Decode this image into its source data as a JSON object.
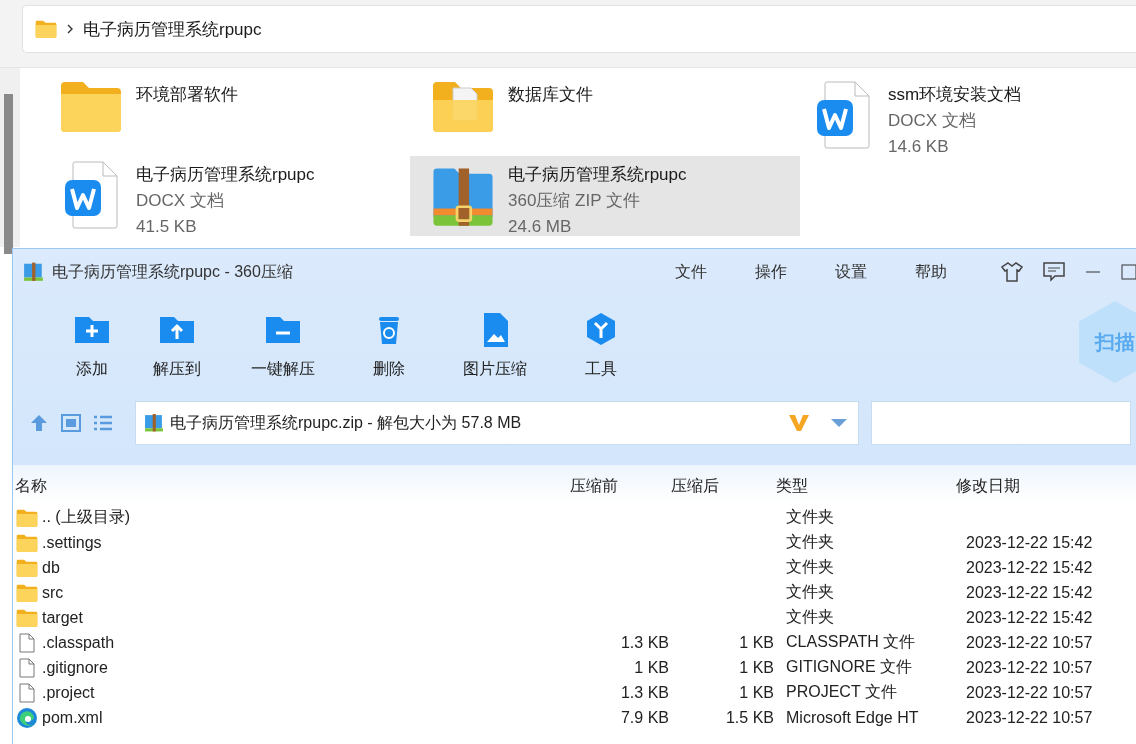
{
  "explorer": {
    "breadcrumb": "电子病历管理系统rpupc",
    "items": [
      {
        "kind": "folder",
        "name": "环境部署软件",
        "selected": false
      },
      {
        "kind": "folder-doc",
        "name": "数据库文件",
        "selected": false
      },
      {
        "kind": "word",
        "name": "ssm环境安装文档",
        "type": "DOCX 文档",
        "size": "14.6 KB",
        "selected": false
      },
      {
        "kind": "word",
        "name": "电子病历管理系统rpupc",
        "type": "DOCX 文档",
        "size": "41.5 KB",
        "selected": false
      },
      {
        "kind": "zip",
        "name": "电子病历管理系统rpupc",
        "type": "360压缩 ZIP 文件",
        "size": "24.6 MB",
        "selected": true
      }
    ]
  },
  "zip_window": {
    "title": "电子病历管理系统rpupc - 360压缩",
    "menu": [
      "文件",
      "操作",
      "设置",
      "帮助"
    ],
    "tools": [
      {
        "kind": "add",
        "label": "添加"
      },
      {
        "kind": "extract-to",
        "label": "解压到"
      },
      {
        "kind": "one-click",
        "label": "一键解压"
      },
      {
        "kind": "delete",
        "label": "删除"
      },
      {
        "kind": "image",
        "label": "图片压缩"
      },
      {
        "kind": "tools",
        "label": "工具"
      }
    ],
    "scan_button": "扫描",
    "path": "电子病历管理系统rpupc.zip - 解包大小为 57.8 MB",
    "columns": [
      "名称",
      "压缩前",
      "压缩后",
      "类型",
      "修改日期"
    ],
    "rows": [
      {
        "kind": "folder",
        "name": ".. (上级目录)",
        "before": "",
        "after": "",
        "type": "文件夹",
        "date": ""
      },
      {
        "kind": "folder",
        "name": ".settings",
        "before": "",
        "after": "",
        "type": "文件夹",
        "date": "2023-12-22 15:42"
      },
      {
        "kind": "folder",
        "name": "db",
        "before": "",
        "after": "",
        "type": "文件夹",
        "date": "2023-12-22 15:42"
      },
      {
        "kind": "folder",
        "name": "src",
        "before": "",
        "after": "",
        "type": "文件夹",
        "date": "2023-12-22 15:42"
      },
      {
        "kind": "folder",
        "name": "target",
        "before": "",
        "after": "",
        "type": "文件夹",
        "date": "2023-12-22 15:42"
      },
      {
        "kind": "file",
        "name": ".classpath",
        "before": "1.3 KB",
        "after": "1 KB",
        "type": "CLASSPATH 文件",
        "date": "2023-12-22 10:57"
      },
      {
        "kind": "file",
        "name": ".gitignore",
        "before": "1 KB",
        "after": "1 KB",
        "type": "GITIGNORE 文件",
        "date": "2023-12-22 10:57"
      },
      {
        "kind": "file",
        "name": ".project",
        "before": "1.3 KB",
        "after": "1 KB",
        "type": "PROJECT 文件",
        "date": "2023-12-22 10:57"
      },
      {
        "kind": "edge",
        "name": "pom.xml",
        "before": "7.9 KB",
        "after": "1.5 KB",
        "type": "Microsoft Edge HT",
        "date": "2023-12-22 10:57"
      }
    ]
  }
}
